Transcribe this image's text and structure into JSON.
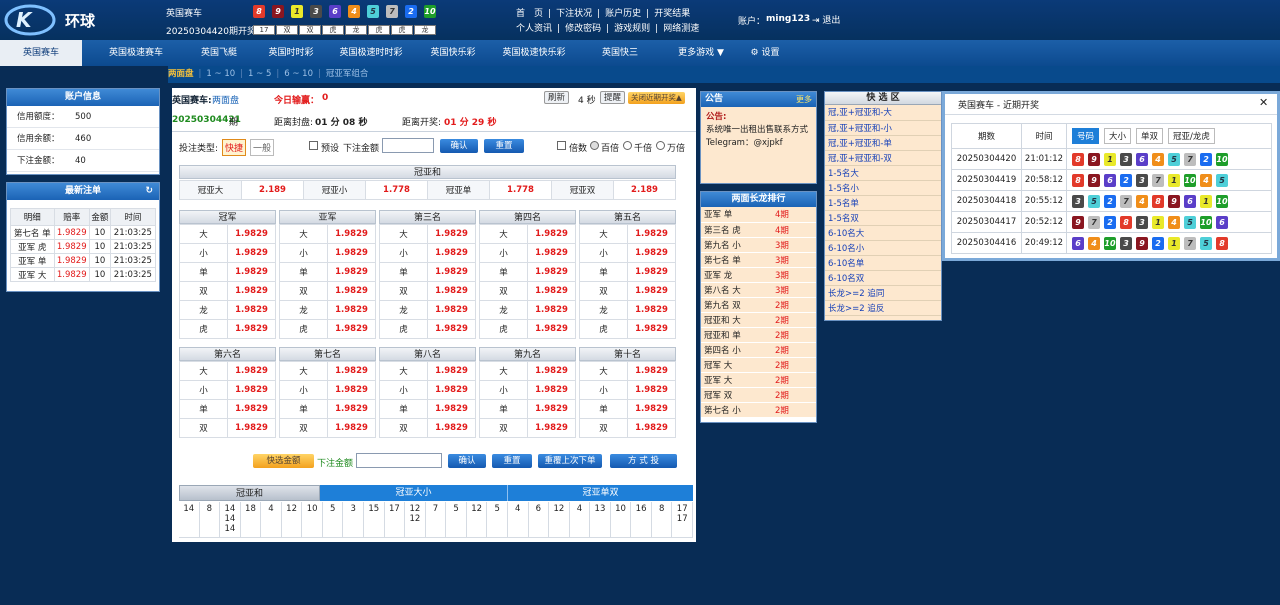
{
  "header": {
    "logo": "K11",
    "brand": "环球",
    "game_name": "英国赛车",
    "period_label": "20250304420期开奖",
    "balls": [
      8,
      9,
      1,
      3,
      6,
      4,
      5,
      7,
      2,
      10
    ],
    "sums": [
      "17",
      "双",
      "双",
      "虎",
      "龙",
      "虎",
      "虎",
      "龙"
    ],
    "links_row1": [
      "首　页",
      "下注状况",
      "账户历史",
      "开奖结果"
    ],
    "links_row2": [
      "个人资讯",
      "修改密码",
      "游戏规则",
      "网络测速"
    ],
    "account_label": "账户：",
    "account_name": "ming123",
    "logout": "退出"
  },
  "nav": {
    "items": [
      "英国赛车",
      "英国极速赛车",
      "英国飞艇",
      "英国时时彩",
      "英国极速时时彩",
      "英国快乐彩",
      "英国极速快乐彩",
      "英国快三",
      "更多游戏 ▼",
      "设置"
    ]
  },
  "subnav": {
    "items": [
      "两面盘",
      "1 ~ 10",
      "1 ~ 5",
      "6 ~ 10",
      "冠亚军组合"
    ]
  },
  "account_panel": {
    "title": "账户信息",
    "rows": [
      [
        "信用额度：",
        "500"
      ],
      [
        "信用余额：",
        "460"
      ],
      [
        "下注金额：",
        "40"
      ]
    ]
  },
  "recent_panel": {
    "title": "最新注单",
    "headers": [
      "明细",
      "赔率",
      "金额",
      "时间"
    ],
    "rows": [
      [
        "第七名 单",
        "1.9829",
        "10",
        "21:03:25"
      ],
      [
        "亚军 虎",
        "1.9829",
        "10",
        "21:03:25"
      ],
      [
        "亚军 单",
        "1.9829",
        "10",
        "21:03:25"
      ],
      [
        "亚军 大",
        "1.9829",
        "10",
        "21:03:25"
      ]
    ]
  },
  "main": {
    "game": "英国赛车:",
    "mode": "两面盘",
    "today_label": "今日输赢：",
    "today_value": "0",
    "refresh": "刷新",
    "seconds": "4 秒",
    "notify": "提醒",
    "close_recent": "关闭近期开奖▲",
    "period": "20250304421",
    "period_suffix": "期",
    "close_label": "距离封盘:",
    "close_time": "01 分 08 秒",
    "open_label": "距离开奖:",
    "open_time": "01 分 29 秒",
    "bet_type_label": "投注类型:",
    "quick": "快捷",
    "normal": "一般",
    "preset": "预设",
    "amount_label": "下注金额",
    "confirm": "确认",
    "reset": "重置",
    "multiple": "倍数",
    "hundred": "百倍",
    "thousand": "千倍",
    "tenthousand": "万倍",
    "gyh_title": "冠亚和",
    "gyh": [
      [
        "冠亚大",
        "2.189"
      ],
      [
        "冠亚小",
        "1.778"
      ],
      [
        "冠亚单",
        "1.778"
      ],
      [
        "冠亚双",
        "2.189"
      ]
    ],
    "groups1": [
      "冠军",
      "亚军",
      "第三名",
      "第四名",
      "第五名"
    ],
    "opts1": [
      "大",
      "小",
      "单",
      "双",
      "龙",
      "虎"
    ],
    "groups2": [
      "第六名",
      "第七名",
      "第八名",
      "第九名",
      "第十名"
    ],
    "opts2": [
      "大",
      "小",
      "单",
      "双"
    ],
    "odd": "1.9829",
    "quick_amount": "快选金额",
    "amount_label2": "下注金额",
    "confirm2": "确认",
    "reset2": "重置",
    "repeat": "重覆上次下单",
    "mode_btn": "方 式 投",
    "tabs": [
      "冠亚和",
      "冠亚大小",
      "冠亚单双"
    ],
    "stats": [
      "14",
      "8",
      "14\n14\n14",
      "18",
      "4",
      "12",
      "10",
      "5",
      "3",
      "15",
      "17",
      "12\n12",
      "7",
      "5",
      "12",
      "5",
      "4",
      "6",
      "12",
      "4",
      "13",
      "10",
      "16",
      "8",
      "17\n17"
    ]
  },
  "notice": {
    "title": "公告",
    "more": "更多",
    "label": "公告:",
    "text": "系统唯一出租出售联系方式Telegram：@xjpkf"
  },
  "longdragon": {
    "title": "两面长龙排行",
    "rows": [
      [
        "亚军 单",
        "4期"
      ],
      [
        "第三名 虎",
        "4期"
      ],
      [
        "第九名 小",
        "3期"
      ],
      [
        "第七名 单",
        "3期"
      ],
      [
        "亚军 龙",
        "3期"
      ],
      [
        "第八名 大",
        "3期"
      ],
      [
        "第九名 双",
        "2期"
      ],
      [
        "冠亚和 大",
        "2期"
      ],
      [
        "冠亚和 单",
        "2期"
      ],
      [
        "第四名 小",
        "2期"
      ],
      [
        "冠军 大",
        "2期"
      ],
      [
        "亚军 大",
        "2期"
      ],
      [
        "冠军 双",
        "2期"
      ],
      [
        "第七名 小",
        "2期"
      ]
    ]
  },
  "quickselect": {
    "title": "快 选 区",
    "items": [
      "冠,亚+冠亚和-大",
      "冠,亚+冠亚和-小",
      "冠,亚+冠亚和-单",
      "冠,亚+冠亚和-双",
      "1-5名大",
      "1-5名小",
      "1-5名单",
      "1-5名双",
      "6-10名大",
      "6-10名小",
      "6-10名单",
      "6-10名双",
      "长龙>=2 追同",
      "长龙>=2 追反"
    ]
  },
  "popup": {
    "title": "英国赛车 - 近期开奖",
    "close": "✕",
    "headers": [
      "期数",
      "时间"
    ],
    "tabs": [
      "号码",
      "大小",
      "单双",
      "冠亚/龙虎"
    ],
    "rows": [
      {
        "period": "20250304420",
        "time": "21:01:12",
        "balls": [
          8,
          9,
          1,
          3,
          6,
          4,
          5,
          7,
          2,
          10
        ]
      },
      {
        "period": "20250304419",
        "time": "20:58:12",
        "balls": [
          8,
          9,
          6,
          2,
          3,
          7,
          1,
          10,
          4,
          5
        ]
      },
      {
        "period": "20250304418",
        "time": "20:55:12",
        "balls": [
          3,
          5,
          2,
          7,
          4,
          8,
          9,
          6,
          1,
          10
        ]
      },
      {
        "period": "20250304417",
        "time": "20:52:12",
        "balls": [
          9,
          7,
          2,
          8,
          3,
          1,
          4,
          5,
          10,
          6
        ]
      },
      {
        "period": "20250304416",
        "time": "20:49:12",
        "balls": [
          6,
          4,
          10,
          3,
          9,
          2,
          1,
          7,
          5,
          8
        ]
      }
    ]
  }
}
